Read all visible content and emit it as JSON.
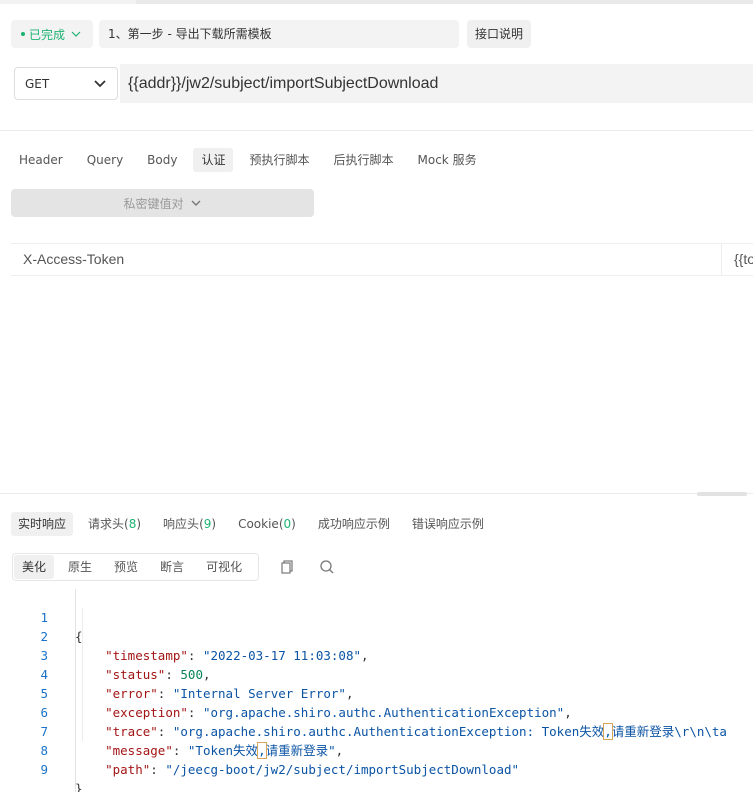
{
  "header": {
    "status_label": "已完成",
    "status_color": "#1eb372",
    "api_name": "1、第一步 - 导出下载所需模板",
    "doc_button": "接口说明"
  },
  "request": {
    "method": "GET",
    "url": "{{addr}}/jw2/subject/importSubjectDownload",
    "tabs": [
      "Header",
      "Query",
      "Body",
      "认证",
      "预执行脚本",
      "后执行脚本",
      "Mock 服务"
    ],
    "active_tab": "认证",
    "kv_toggle_label": "私密键值对",
    "auth_key": "X-Access-Token",
    "auth_value": "{{to"
  },
  "response": {
    "tabs": [
      {
        "label": "实时响应",
        "count": ""
      },
      {
        "label": "请求头",
        "count": "8"
      },
      {
        "label": "响应头",
        "count": "9"
      },
      {
        "label": "Cookie",
        "count": "0"
      },
      {
        "label": "成功响应示例",
        "count": ""
      },
      {
        "label": "错误响应示例",
        "count": ""
      }
    ],
    "view_tabs": [
      "美化",
      "原生",
      "预览",
      "断言",
      "可视化"
    ],
    "tool_icons": [
      "copy-icon",
      "search-icon"
    ],
    "body_lines": [
      {
        "num": "1",
        "text": "{"
      },
      {
        "num": "2",
        "key": "\"timestamp\"",
        "value": "\"2022-03-17 11:03:08\"",
        "trail": ","
      },
      {
        "num": "3",
        "key": "\"status\"",
        "value": "500",
        "trail": ",",
        "numeric": true
      },
      {
        "num": "4",
        "key": "\"error\"",
        "value": "\"Internal Server Error\"",
        "trail": ","
      },
      {
        "num": "5",
        "key": "\"exception\"",
        "value": "\"org.apache.shiro.authc.AuthenticationException\"",
        "trail": ","
      },
      {
        "num": "6",
        "key": "\"trace\"",
        "value_a": "\"org.apache.shiro.authc.AuthenticationException: Token失效",
        "hl": ",",
        "value_b": "请重新登录\\r\\n\\ta"
      },
      {
        "num": "7",
        "key": "\"message\"",
        "value_a": "\"Token失效",
        "hl": ",",
        "value_b": "请重新登录\"",
        "trail": ","
      },
      {
        "num": "8",
        "key": "\"path\"",
        "value": "\"/jeecg-boot/jw2/subject/importSubjectDownload\""
      },
      {
        "num": "9",
        "text": "}"
      }
    ]
  }
}
